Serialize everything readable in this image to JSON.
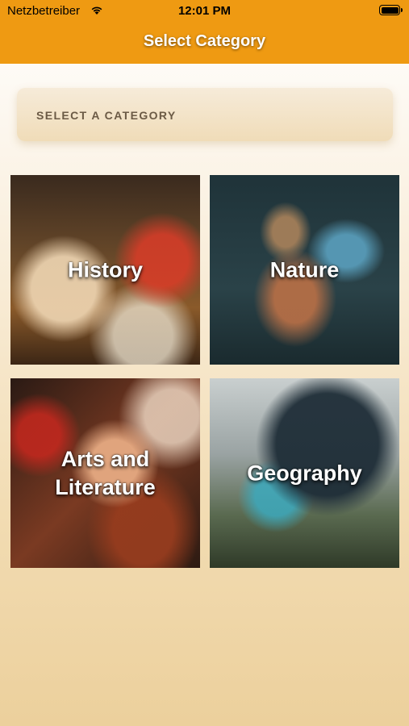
{
  "status_bar": {
    "carrier": "Netzbetreiber",
    "time": "12:01 PM"
  },
  "nav": {
    "title": "Select Category"
  },
  "selector": {
    "label": "SELECT A CATEGORY"
  },
  "categories": [
    {
      "label": "History"
    },
    {
      "label": "Nature"
    },
    {
      "label": "Arts and Literature"
    },
    {
      "label": "Geography"
    }
  ],
  "colors": {
    "nav_bar": "#ef9a12",
    "title_text": "#ffffff",
    "background_bottom": "#ecd09c"
  }
}
